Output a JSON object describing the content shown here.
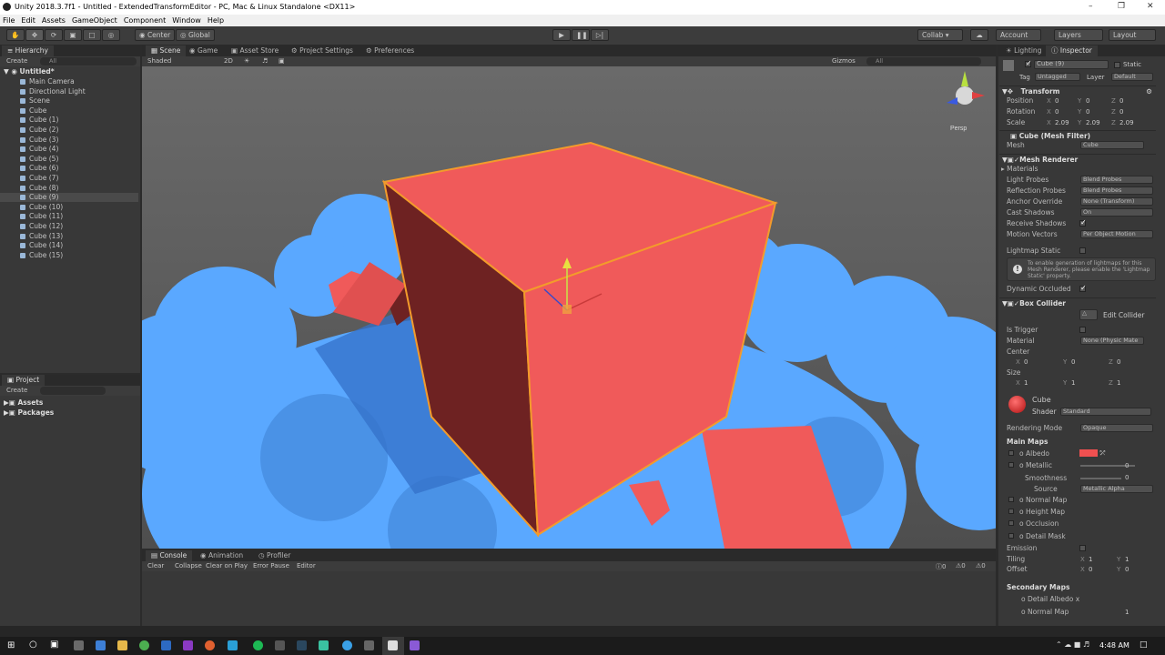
{
  "window": {
    "title": "Unity 2018.3.7f1 - Untitled - ExtendedTransformEditor - PC, Mac & Linux Standalone <DX11>"
  },
  "menu": [
    "File",
    "Edit",
    "Assets",
    "GameObject",
    "Component",
    "Window",
    "Help"
  ],
  "toolbar": {
    "pivot": "Center",
    "space": "Global",
    "collab": "Collab ▾",
    "account": "Account",
    "layers": "Layers",
    "layout": "Layout"
  },
  "hierarchy": {
    "tab": "Hierarchy",
    "create": "Create",
    "search": "All",
    "scene": "Untitled*",
    "items": [
      "Main Camera",
      "Directional Light",
      "Scene",
      "Cube",
      "Cube (1)",
      "Cube (2)",
      "Cube (3)",
      "Cube (4)",
      "Cube (5)",
      "Cube (6)",
      "Cube (7)",
      "Cube (8)",
      "Cube (9)",
      "Cube (10)",
      "Cube (11)",
      "Cube (12)",
      "Cube (13)",
      "Cube (14)",
      "Cube (15)"
    ],
    "selected": "Cube (9)"
  },
  "project": {
    "tab": "Project",
    "create": "Create",
    "folders": [
      "Assets",
      "Packages"
    ]
  },
  "scene": {
    "tabs": [
      "Scene",
      "Game",
      "Asset Store",
      "Project Settings",
      "Preferences"
    ],
    "shading": "Shaded",
    "mode2d": "2D",
    "gizmos": "Gizmos",
    "search": "All",
    "persp": "Persp"
  },
  "console": {
    "tabs": [
      "Console",
      "Animation",
      "Profiler"
    ],
    "buttons": [
      "Clear",
      "Collapse",
      "Clear on Play",
      "Error Pause",
      "Editor"
    ],
    "counts": [
      "0",
      "0",
      "0"
    ]
  },
  "inspector": {
    "tabs": [
      "Lighting",
      "Inspector"
    ],
    "object_name": "Cube (9)",
    "static_label": "Static",
    "tag_label": "Tag",
    "tag": "Untagged",
    "layer_label": "Layer",
    "layer": "Default",
    "transform": {
      "title": "Transform",
      "position_label": "Position",
      "rotation_label": "Rotation",
      "scale_label": "Scale",
      "position": [
        "X",
        "0",
        "Y",
        "0",
        "Z",
        "0"
      ],
      "rotation": [
        "X",
        "0",
        "Y",
        "0",
        "Z",
        "0"
      ],
      "scale": [
        "X",
        "2.09",
        "Y",
        "2.09",
        "Z",
        "2.09"
      ]
    },
    "mesh_filter": {
      "title": "Cube (Mesh Filter)",
      "mesh_label": "Mesh",
      "mesh": "Cube"
    },
    "mesh_renderer": {
      "title": "Mesh Renderer",
      "materials": "Materials",
      "rows": [
        [
          "Light Probes",
          "Blend Probes"
        ],
        [
          "Reflection Probes",
          "Blend Probes"
        ],
        [
          "Anchor Override",
          "None (Transform)"
        ],
        [
          "Cast Shadows",
          "On"
        ]
      ],
      "receive_shadows": "Receive Shadows",
      "motion_vectors": "Motion Vectors",
      "motion_value": "Per Object Motion",
      "lightmap_static": "Lightmap Static",
      "info": "To enable generation of lightmaps for this Mesh Renderer, please enable the 'Lightmap Static' property.",
      "dynamic_occluded": "Dynamic Occluded"
    },
    "box_collider": {
      "title": "Box Collider",
      "edit": "Edit Collider",
      "is_trigger": "Is Trigger",
      "material_label": "Material",
      "material": "None (Physic Mate",
      "center_label": "Center",
      "center": [
        "X",
        "0",
        "Y",
        "0",
        "Z",
        "0"
      ],
      "size_label": "Size",
      "size": [
        "X",
        "1",
        "Y",
        "1",
        "Z",
        "1"
      ]
    },
    "material": {
      "name": "Cube",
      "shader_label": "Shader",
      "shader": "Standard",
      "rendering_mode_label": "Rendering Mode",
      "rendering_mode": "Opaque",
      "main_maps": "Main Maps",
      "albedo": "Albedo",
      "metallic": "Metallic",
      "metallic_value": "0",
      "smoothness": "Smoothness",
      "smoothness_value": "0",
      "source": "Source",
      "source_value": "Metallic Alpha",
      "normal_map": "Normal Map",
      "height_map": "Height Map",
      "occlusion": "Occlusion",
      "detail_mask": "Detail Mask",
      "emission": "Emission",
      "tiling": "Tiling",
      "tiling_vals": [
        "X",
        "1",
        "Y",
        "1"
      ],
      "offset": "Offset",
      "offset_vals": [
        "X",
        "0",
        "Y",
        "0"
      ],
      "secondary_maps": "Secondary Maps",
      "detail_albedo": "Detail Albedo x",
      "normal_map2": "Normal Map",
      "normal_map2_value": "1",
      "albedo_color": "#f05050"
    }
  },
  "taskbar": {
    "time": "4:48 AM"
  },
  "colors": {
    "cube": "#f05a5a",
    "cube_dark": "#6e2222",
    "sphere": "#5aa8ff",
    "bg": "#5c5c5c",
    "outline": "#f39b2b"
  }
}
